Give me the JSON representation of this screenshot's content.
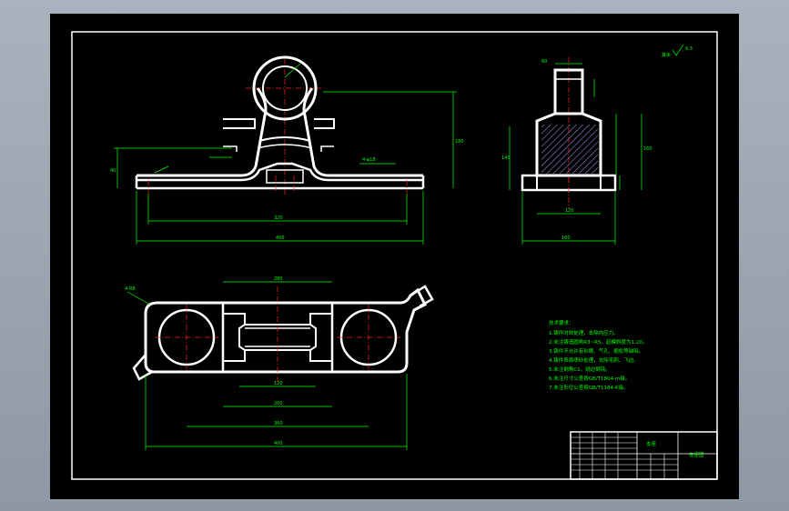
{
  "sheet": {
    "title_block": {
      "part_name": "支座",
      "drawing_code": "支座图"
    },
    "roughness_mark": "其余",
    "roughness_value": "6.3",
    "notes": {
      "heading": "技术要求：",
      "items": [
        "1.铸件时效处理，去除内应力。",
        "2.未注铸造圆角R3~R5，起模斜度为1:20。",
        "3.铸件不允许有砂眼、气孔、缩松等缺陷。",
        "4.铸件表面喷砂处理，去除毛刺、飞边。",
        "5.未注倒角C1，锐边倒钝。",
        "6.未注尺寸公差按GB/T1804-m级。",
        "7.未注形位公差按GB/T1184-K级。"
      ]
    },
    "dims": {
      "front_bottom_inner": "320",
      "front_bottom_total": "400",
      "front_height": "180",
      "front_side": "40",
      "front_slot": "4-φ18",
      "side_top": "60",
      "side_width": "120",
      "side_base": "160",
      "side_height": "160",
      "side_left": "140",
      "top_length": "280",
      "top_a": "120",
      "top_b": "200",
      "top_c": "400",
      "top_d": "360",
      "top_corner": "4-R8"
    }
  }
}
